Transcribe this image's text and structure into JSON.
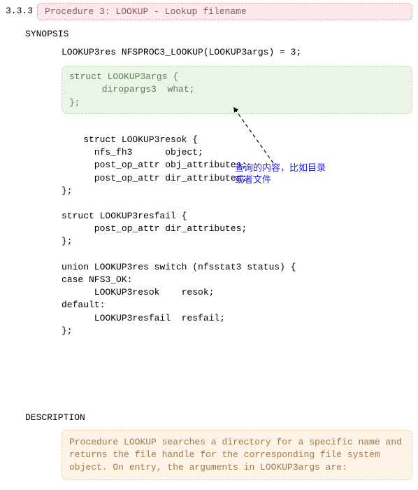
{
  "section_number": "3.3.3",
  "title": "Procedure 3: LOOKUP -  Lookup filename",
  "synopsis_heading": "SYNOPSIS",
  "proto_line": "LOOKUP3res NFSPROC3_LOOKUP(LOOKUP3args) = 3;",
  "args_struct": "struct LOOKUP3args {\n      diropargs3  what;\n};",
  "code_block": "struct LOOKUP3resok {\n      nfs_fh3      object;\n      post_op_attr obj_attributes;\n      post_op_attr dir_attributes;\n};\n\nstruct LOOKUP3resfail {\n      post_op_attr dir_attributes;\n};\n\nunion LOOKUP3res switch (nfsstat3 status) {\ncase NFS3_OK:\n      LOOKUP3resok    resok;\ndefault:\n      LOOKUP3resfail  resfail;\n};",
  "annotation_line1": "查询的内容，比如目录",
  "annotation_line2": "或者文件",
  "description_heading": "DESCRIPTION",
  "description_text": "Procedure LOOKUP searches a directory for a specific name and returns the file handle for the corresponding file system object. On entry, the arguments in LOOKUP3args are:"
}
